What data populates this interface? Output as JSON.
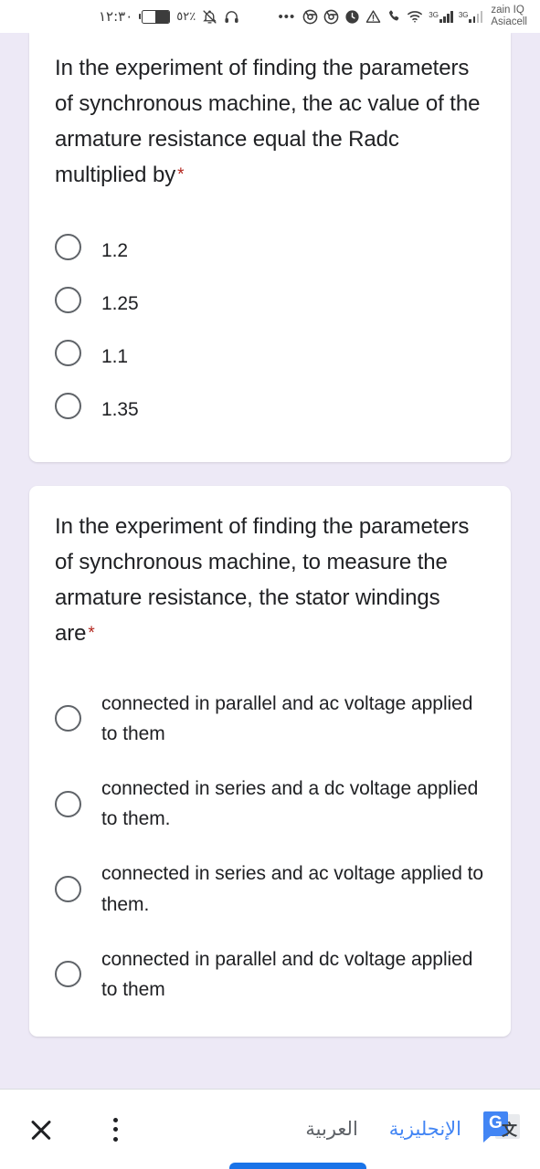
{
  "status_bar": {
    "time": "١٢:٣٠",
    "battery_percent": "٥٢٪",
    "battery_level": 52,
    "left_icons": [
      "battery-icon",
      "mute-bell-icon",
      "headphones-icon"
    ],
    "more_icon": "•••",
    "right_icons": [
      "chrome-icon",
      "chrome-icon",
      "clock-icon",
      "warning-icon",
      "phone-call-icon",
      "wifi-icon"
    ],
    "network_badge_1": "3G",
    "network_badge_2": "3G",
    "carrier_line1": "zain IQ",
    "carrier_line2": "Asiacell"
  },
  "questions": [
    {
      "title": "In the experiment of finding the parameters of synchronous machine, the ac value of the armature resistance equal the Radc multiplied by",
      "required_marker": "*",
      "options": [
        {
          "label": "1.2",
          "selected": false
        },
        {
          "label": "1.25",
          "selected": false
        },
        {
          "label": "1.1",
          "selected": false
        },
        {
          "label": "1.35",
          "selected": false
        }
      ]
    },
    {
      "title": "In the experiment of finding the parameters of synchronous machine, to measure the armature resistance, the stator windings are",
      "required_marker": "*",
      "options": [
        {
          "label": "connected in parallel and ac voltage applied to them",
          "selected": false
        },
        {
          "label": "connected in series and a dc voltage applied to them.",
          "selected": false
        },
        {
          "label": "connected in series and ac voltage applied to them.",
          "selected": false
        },
        {
          "label": "connected in parallel and dc voltage applied to them",
          "selected": false
        }
      ]
    }
  ],
  "translate_bar": {
    "close_icon": "close-icon",
    "menu_icon": "kebab-menu-icon",
    "source_language": "العربية",
    "target_language": "الإنجليزية",
    "active_language": "الإنجليزية",
    "logo_icon": "google-translate-icon",
    "logo_letter": "G",
    "logo_glyph": "文"
  },
  "colors": {
    "page_background": "#ede9f6",
    "card_background": "#ffffff",
    "text_primary": "#202124",
    "required_star": "#b3261e",
    "radio_outline": "#5f6368",
    "accent_blue": "#4285f4",
    "nav_pill": "#1a73e8",
    "muted_text": "#5f6368"
  }
}
